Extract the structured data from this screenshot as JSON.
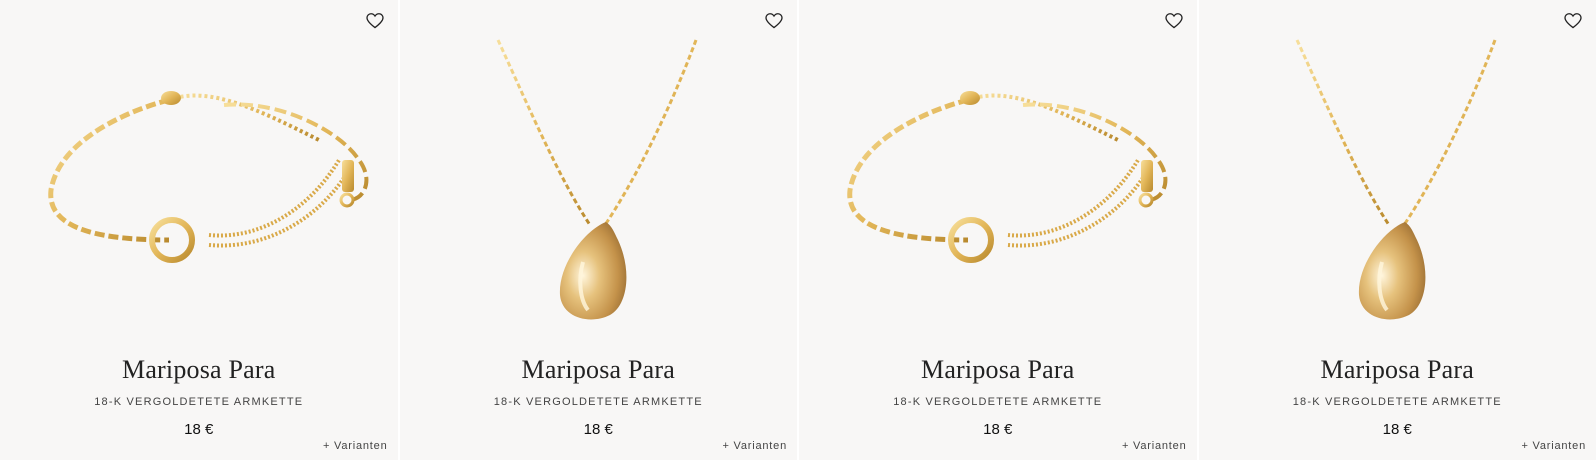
{
  "products": [
    {
      "type": "bracelet",
      "name": "Mariposa Para",
      "subtitle": "18-K VERGOLDETETE ARMKETTE",
      "price": "18 €",
      "variants_label": "+ Varianten",
      "favorite_icon": "heart-outline-icon"
    },
    {
      "type": "necklace",
      "name": "Mariposa Para",
      "subtitle": "18-K VERGOLDETETE ARMKETTE",
      "price": "18 €",
      "variants_label": "+ Varianten",
      "favorite_icon": "heart-outline-icon"
    },
    {
      "type": "bracelet",
      "name": "Mariposa Para",
      "subtitle": "18-K VERGOLDETETE ARMKETTE",
      "price": "18 €",
      "variants_label": "+ Varianten",
      "favorite_icon": "heart-outline-icon"
    },
    {
      "type": "necklace",
      "name": "Mariposa Para",
      "subtitle": "18-K VERGOLDETETE ARMKETTE",
      "price": "18 €",
      "variants_label": "+ Varianten",
      "favorite_icon": "heart-outline-icon"
    }
  ],
  "colors": {
    "card_bg": "#f8f7f6",
    "gold": "#e2b658",
    "gold_dark": "#b98a2e"
  }
}
